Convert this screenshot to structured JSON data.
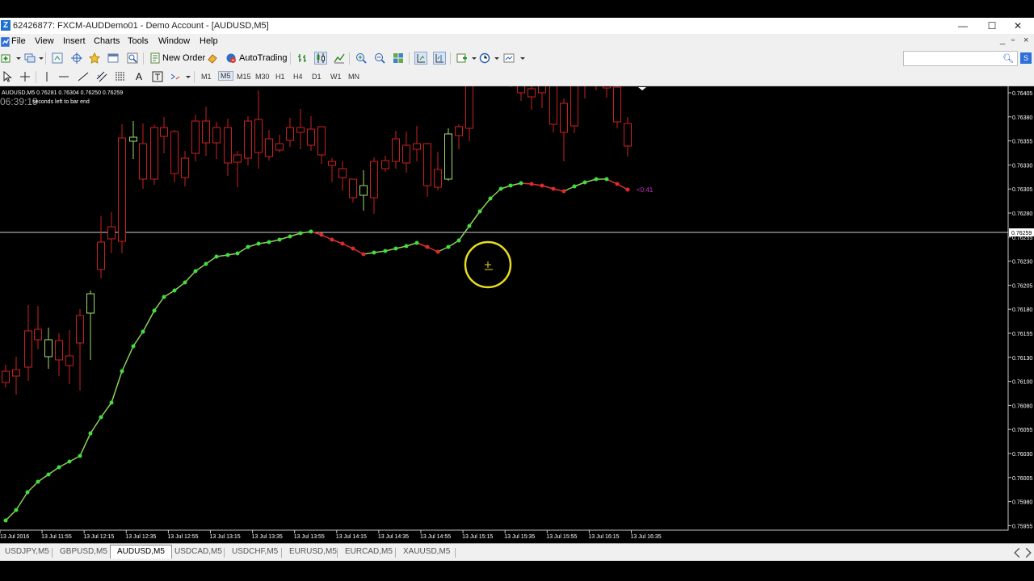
{
  "window": {
    "title": "62426877: FXCM-AUDDemo01 - Demo Account - [AUDUSD,M5]",
    "controls": [
      "—",
      "☐",
      "✕"
    ]
  },
  "menu": {
    "items": [
      "File",
      "View",
      "Insert",
      "Charts",
      "Tools",
      "Window",
      "Help"
    ],
    "mdi_controls": [
      "_",
      "▫",
      "×"
    ]
  },
  "toolbar": {
    "new_order": "New Order",
    "autotrading": "AutoTrading"
  },
  "timeframes": [
    "M1",
    "M5",
    "M15",
    "M30",
    "H1",
    "H4",
    "D1",
    "W1",
    "MN"
  ],
  "active_timeframe": "M5",
  "chart": {
    "symbol_info": "AUDUSD,M5  0.76281 0.76304 0.76250 0.76259",
    "timer_big": "06:39:19",
    "timer_note": "seconds left to bar end",
    "bar_countdown": "<0:41",
    "bull_color": "#9ee06a",
    "bear_color": "#cc1f1f",
    "price_line": "0.76259",
    "price_labels": [
      "0.76405",
      "0.76380",
      "0.76355",
      "0.76330",
      "0.76305",
      "0.76280",
      "0.76255",
      "0.76230",
      "0.76205",
      "0.76180",
      "0.76155",
      "0.76130",
      "0.76100",
      "0.76080",
      "0.76055",
      "0.76030",
      "0.76005",
      "0.75980",
      "0.75955"
    ],
    "time_labels": [
      "13 Jul 2016",
      "13 Jul 11:55",
      "13 Jul 12:15",
      "13 Jul 12:35",
      "13 Jul 12:55",
      "13 Jul 13:15",
      "13 Jul 13:35",
      "13 Jul 13:55",
      "13 Jul 14:15",
      "13 Jul 14:35",
      "13 Jul 14:55",
      "13 Jul 15:15",
      "13 Jul 15:35",
      "13 Jul 15:55",
      "13 Jul 16:15",
      "13 Jul 16:35"
    ]
  },
  "tabs": [
    "USDJPY,M5",
    "GBPUSD,M5",
    "AUDUSD,M5",
    "USDCAD,M5",
    "USDCHF,M5",
    "EURUSD,M5",
    "EURCAD,M5",
    "XAUUSD,M5"
  ],
  "active_tab": "AUDUSD,M5"
}
